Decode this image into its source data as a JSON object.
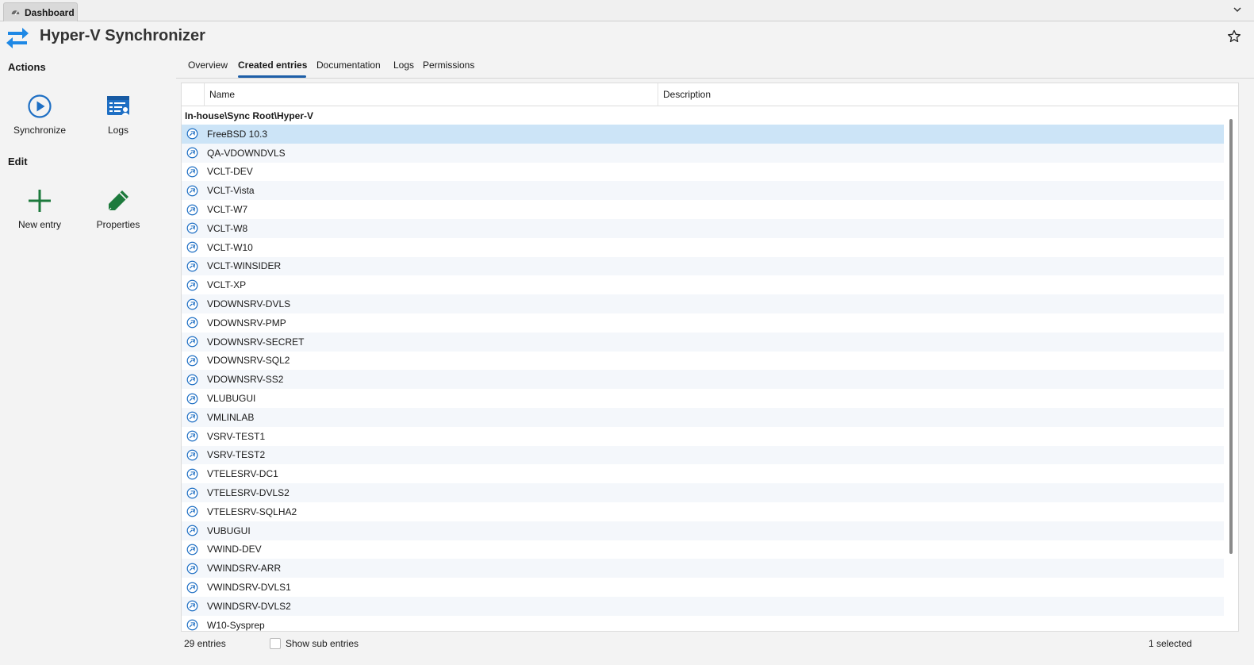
{
  "tabstrip": {
    "tab_label": "Dashboard",
    "tab_icon": "dashboard-gauge-icon"
  },
  "header": {
    "title": "Hyper-V Synchronizer",
    "accent": "#1e88e5"
  },
  "actions": {
    "title": "Actions",
    "items": [
      {
        "label": "Synchronize",
        "icon": "play-circle-icon"
      },
      {
        "label": "Logs",
        "icon": "logs-icon"
      }
    ]
  },
  "edit": {
    "title": "Edit",
    "items": [
      {
        "label": "New entry",
        "icon": "plus-icon"
      },
      {
        "label": "Properties",
        "icon": "pencil-icon"
      }
    ]
  },
  "tabs": [
    {
      "label": "Overview"
    },
    {
      "label": "Created entries",
      "active": true
    },
    {
      "label": "Documentation"
    },
    {
      "label": "Logs"
    },
    {
      "label": "Permissions"
    }
  ],
  "grid": {
    "columns": [
      "Name",
      "Description"
    ],
    "group": "In-house\\Sync Root\\Hyper-V",
    "rows": [
      {
        "name": "FreeBSD 10.3",
        "selected": true
      },
      {
        "name": "QA-VDOWNDVLS"
      },
      {
        "name": "VCLT-DEV"
      },
      {
        "name": "VCLT-Vista"
      },
      {
        "name": "VCLT-W7"
      },
      {
        "name": "VCLT-W8"
      },
      {
        "name": "VCLT-W10"
      },
      {
        "name": "VCLT-WINSIDER"
      },
      {
        "name": "VCLT-XP"
      },
      {
        "name": "VDOWNSRV-DVLS"
      },
      {
        "name": "VDOWNSRV-PMP"
      },
      {
        "name": "VDOWNSRV-SECRET"
      },
      {
        "name": "VDOWNSRV-SQL2"
      },
      {
        "name": "VDOWNSRV-SS2"
      },
      {
        "name": "VLUBUGUI"
      },
      {
        "name": "VMLINLAB"
      },
      {
        "name": "VSRV-TEST1"
      },
      {
        "name": "VSRV-TEST2"
      },
      {
        "name": "VTELESRV-DC1"
      },
      {
        "name": "VTELESRV-DVLS2"
      },
      {
        "name": "VTELESRV-SQLHA2"
      },
      {
        "name": "VUBUGUI"
      },
      {
        "name": "VWIND-DEV"
      },
      {
        "name": "VWINDSRV-ARR"
      },
      {
        "name": "VWINDSRV-DVLS1"
      },
      {
        "name": "VWINDSRV-DVLS2"
      },
      {
        "name": "W10-Sysprep"
      }
    ]
  },
  "status": {
    "count_text": "29 entries",
    "show_sub_entries_label": "Show sub entries",
    "show_sub_entries_checked": false,
    "selected_text": "1 selected"
  }
}
